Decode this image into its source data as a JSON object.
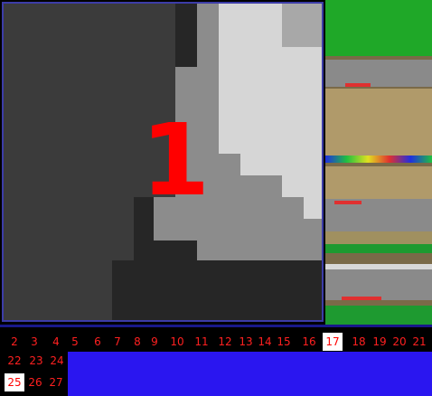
{
  "zoom_view": {
    "selected_number": "1"
  },
  "level_selector": {
    "selected": [
      "17",
      "25"
    ],
    "rows": [
      [
        "2",
        "3",
        "4",
        "5",
        "6",
        "7",
        "8",
        "9",
        "10",
        "11",
        "12",
        "13",
        "14",
        "15",
        "16",
        "17",
        "18",
        "19",
        "20",
        "21"
      ],
      [
        "22",
        "23",
        "24"
      ],
      [
        "25",
        "26",
        "27"
      ]
    ]
  },
  "colors": {
    "accent_red": "#ff0000",
    "selector_highlight": "#ffffff",
    "tray_bar": "#2a16f0",
    "frame_border": "#3c3ca8"
  }
}
